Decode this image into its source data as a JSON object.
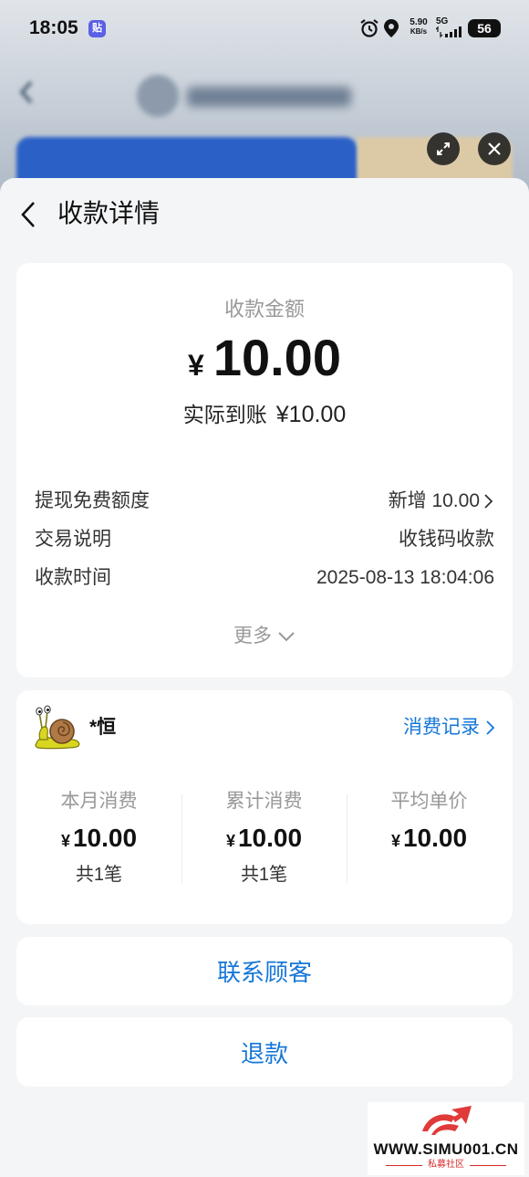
{
  "status_bar": {
    "time": "18:05",
    "app_badge": "贴",
    "net_speed_value": "5.90",
    "net_speed_unit": "KB/s",
    "network": "5G",
    "battery": "56"
  },
  "header": {
    "title": "收款详情"
  },
  "summary": {
    "amount_label": "收款金额",
    "currency": "¥",
    "amount": "10.00",
    "received_label": "实际到账",
    "received_value": "¥10.00",
    "rows": [
      {
        "label": "提现免费额度",
        "value": "新增 10.00"
      },
      {
        "label": "交易说明",
        "value": "收钱码收款"
      },
      {
        "label": "收款时间",
        "value": "2025-08-13 18:04:06"
      }
    ],
    "more_label": "更多"
  },
  "customer": {
    "name": "*恒",
    "records_link": "消费记录",
    "stats": [
      {
        "label": "本月消费",
        "currency": "¥",
        "value": "10.00",
        "count": "共1笔"
      },
      {
        "label": "累计消费",
        "currency": "¥",
        "value": "10.00",
        "count": "共1笔"
      },
      {
        "label": "平均单价",
        "currency": "¥",
        "value": "10.00"
      }
    ]
  },
  "actions": {
    "contact_label": "联系顾客",
    "refund_label": "退款"
  },
  "watermark": {
    "url": "WWW.SIMU001.CN",
    "name": "私募社区"
  },
  "icons": {
    "back": "chevron-left-icon",
    "expand": "expand-icon",
    "close": "close-icon",
    "more": "chevron-down-icon",
    "row_link": "chevron-right-icon",
    "avatar": "snail-avatar-icon"
  },
  "colors": {
    "accent": "#1677d8",
    "sheet_background": "#f4f5f7",
    "card_background": "#ffffff",
    "muted_text": "#999999",
    "primary_text": "#333333",
    "watermark_red": "#d62b2b"
  }
}
